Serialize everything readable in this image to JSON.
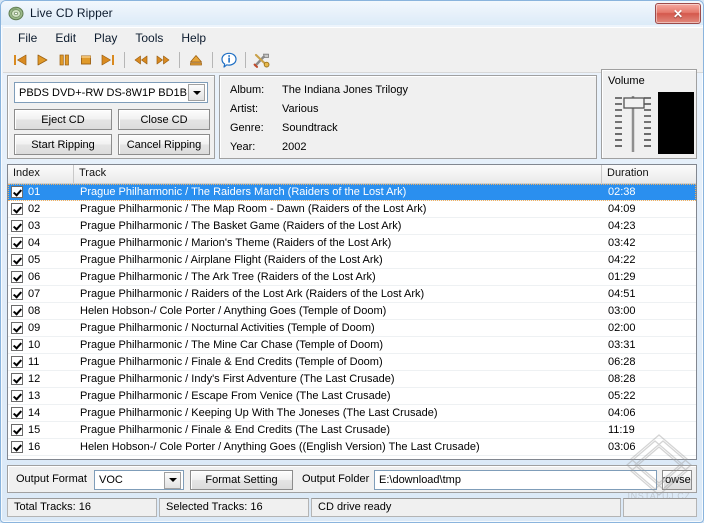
{
  "window": {
    "title": "Live CD Ripper",
    "app_icon": "cd-disc-icon",
    "close_label": "✕"
  },
  "menubar": {
    "items": [
      {
        "label": "File"
      },
      {
        "label": "Edit"
      },
      {
        "label": "Play"
      },
      {
        "label": "Tools"
      },
      {
        "label": "Help"
      }
    ]
  },
  "toolbar": {
    "buttons": [
      {
        "name": "previous-track-icon",
        "glyph": "prev"
      },
      {
        "name": "play-icon",
        "glyph": "play"
      },
      {
        "name": "pause-icon",
        "glyph": "pause"
      },
      {
        "name": "stop-icon",
        "glyph": "stop"
      },
      {
        "name": "next-track-icon",
        "glyph": "next"
      },
      {
        "name": "rewind-icon",
        "glyph": "rew"
      },
      {
        "name": "fast-forward-icon",
        "glyph": "ff"
      },
      {
        "name": "eject-icon",
        "glyph": "eject"
      },
      {
        "name": "info-icon",
        "glyph": "info"
      },
      {
        "name": "tools-icon",
        "glyph": "tools"
      }
    ]
  },
  "drive_panel": {
    "selected_drive": "PBDS DVD+-RW DS-8W1P BD1B",
    "eject_cd_label": "Eject CD",
    "close_cd_label": "Close CD",
    "start_ripping_label": "Start Ripping",
    "cancel_ripping_label": "Cancel Ripping"
  },
  "album_panel": {
    "album_label": "Album:",
    "album_value": "The Indiana Jones Trilogy",
    "artist_label": "Artist:",
    "artist_value": "Various",
    "genre_label": "Genre:",
    "genre_value": "Soundtrack",
    "year_label": "Year:",
    "year_value": "2002"
  },
  "volume_panel": {
    "label": "Volume",
    "slider_position_percent": 82
  },
  "track_list": {
    "columns": [
      "Index",
      "Track",
      "Duration"
    ],
    "selected_index": 0,
    "rows": [
      {
        "checked": true,
        "index": "01",
        "track": "Prague Philharmonic / The Raiders March (Raiders of the Lost Ark)",
        "duration": "02:38"
      },
      {
        "checked": true,
        "index": "02",
        "track": "Prague Philharmonic / The Map Room - Dawn (Raiders of the Lost Ark)",
        "duration": "04:09"
      },
      {
        "checked": true,
        "index": "03",
        "track": "Prague Philharmonic / The Basket Game (Raiders of the Lost Ark)",
        "duration": "04:23"
      },
      {
        "checked": true,
        "index": "04",
        "track": "Prague Philharmonic / Marion's Theme (Raiders of the Lost Ark)",
        "duration": "03:42"
      },
      {
        "checked": true,
        "index": "05",
        "track": "Prague Philharmonic / Airplane Flight (Raiders of the Lost Ark)",
        "duration": "04:22"
      },
      {
        "checked": true,
        "index": "06",
        "track": "Prague Philharmonic / The Ark Tree (Raiders of the Lost Ark)",
        "duration": "01:29"
      },
      {
        "checked": true,
        "index": "07",
        "track": "Prague Philharmonic / Raiders of the Lost Ark (Raiders of the Lost Ark)",
        "duration": "04:51"
      },
      {
        "checked": true,
        "index": "08",
        "track": "Helen Hobson-/ Cole Porter / Anything Goes (Temple of Doom)",
        "duration": "03:00"
      },
      {
        "checked": true,
        "index": "09",
        "track": "Prague Philharmonic / Nocturnal Activities (Temple of Doom)",
        "duration": "02:00"
      },
      {
        "checked": true,
        "index": "10",
        "track": "Prague Philharmonic / The Mine Car Chase (Temple of Doom)",
        "duration": "03:31"
      },
      {
        "checked": true,
        "index": "11",
        "track": "Prague Philharmonic / Finale & End Credits (Temple of Doom)",
        "duration": "06:28"
      },
      {
        "checked": true,
        "index": "12",
        "track": "Prague Philharmonic / Indy's First Adventure (The Last Crusade)",
        "duration": "08:28"
      },
      {
        "checked": true,
        "index": "13",
        "track": "Prague Philharmonic / Escape From Venice (The Last Crusade)",
        "duration": "05:22"
      },
      {
        "checked": true,
        "index": "14",
        "track": "Prague Philharmonic / Keeping Up With The Joneses (The Last Crusade)",
        "duration": "04:06"
      },
      {
        "checked": true,
        "index": "15",
        "track": "Prague Philharmonic / Finale & End Credits (The Last Crusade)",
        "duration": "11:19"
      },
      {
        "checked": true,
        "index": "16",
        "track": "Helen Hobson-/ Cole Porter / Anything Goes ((English Version) The Last Crusade)",
        "duration": "03:06"
      }
    ]
  },
  "output_bar": {
    "format_label": "Output Format",
    "format_value": "VOC",
    "format_setting_label": "Format Setting",
    "folder_label": "Output Folder",
    "folder_value": "E:\\download\\tmp",
    "browse_label": "Browse..."
  },
  "statusbar": {
    "total_tracks": "Total Tracks: 16",
    "selected_tracks": "Selected Tracks: 16",
    "drive_status": "CD drive ready",
    "extra": ""
  },
  "watermark": {
    "text": "INSTALUJ.CZ"
  },
  "colors": {
    "selection_blue": "#2a8fef",
    "toolbar_orange": "#d98a20",
    "title_gradient_top": "#f3f8fd",
    "close_red": "#d4584c"
  }
}
